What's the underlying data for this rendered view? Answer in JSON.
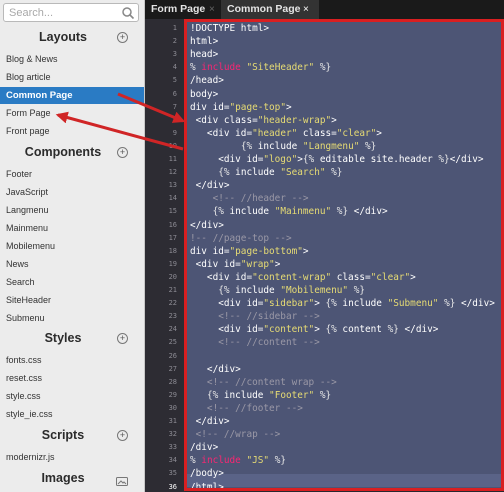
{
  "search": {
    "placeholder": "Search..."
  },
  "sidebar": {
    "sections": [
      {
        "title": "Layouts",
        "action": "+",
        "items": [
          "Blog & News",
          "Blog article",
          "Common Page",
          "Form Page",
          "Front page"
        ]
      },
      {
        "title": "Components",
        "action": "+",
        "items": [
          "Footer",
          "JavaScript",
          "Langmenu",
          "Mainmenu",
          "Mobilemenu",
          "News",
          "Search",
          "SiteHeader",
          "Submenu"
        ]
      },
      {
        "title": "Styles",
        "action": "+",
        "items": [
          "fonts.css",
          "reset.css",
          "style.css",
          "style_ie.css"
        ]
      },
      {
        "title": "Scripts",
        "action": "+",
        "items": [
          "modernizr.js"
        ]
      },
      {
        "title": "Images",
        "action": "images-icon",
        "items": []
      }
    ],
    "active_item": "Common Page"
  },
  "tabs": [
    {
      "label": "Form Page",
      "close": "×"
    },
    {
      "label": "Common Page",
      "close": "×"
    }
  ],
  "editor": {
    "line_numbers": [
      "1",
      "2",
      "3",
      "4",
      "5",
      "6",
      "7",
      "8",
      "9",
      "10",
      "11",
      "12",
      "13",
      "14",
      "15",
      "16",
      "17",
      "18",
      "19",
      "20",
      "21",
      "22",
      "23",
      "24",
      "25",
      "26",
      "27",
      "28",
      "29",
      "30",
      "31",
      "32",
      "33",
      "34",
      "35",
      "36"
    ],
    "lines": [
      "!DOCTYPE html>",
      "html>",
      "head>",
      "% include \"SiteHeader\" %}",
      "/head>",
      "body>",
      "div id=\"page-top\">",
      " <div class=\"header-wrap\">",
      "   <div id=\"header\" class=\"clear\">",
      "         {% include \"Langmenu\" %}",
      "     <div id=\"logo\">{% editable site.header %}</div>",
      "     {% include \"Search\" %}",
      " </div>",
      "    <!-- //header -->",
      "    {% include \"Mainmenu\" %} </div>",
      "</div>",
      "!-- //page-top -->",
      "div id=\"page-bottom\">",
      " <div id=\"wrap\">",
      "   <div id=\"content-wrap\" class=\"clear\">",
      "     {% include \"Mobilemenu\" %}",
      "     <div id=\"sidebar\"> {% include \"Submenu\" %} </div>",
      "     <!-- //sidebar -->",
      "     <div id=\"content\"> {% content %} </div>",
      "     <!-- //content -->",
      "",
      "   </div>",
      "   <!-- //content wrap -->",
      "   {% include \"Footer\" %}",
      "   <!-- //footer -->",
      " </div>",
      " <!-- //wrap -->",
      "/div>",
      "% include \"JS\" %}",
      "/body>",
      "/html>"
    ]
  },
  "colors": {
    "accent": "#2a7bc4",
    "highlight_border": "#d91f21",
    "selection": "#4d5575",
    "editor_bg": "#29282f"
  }
}
